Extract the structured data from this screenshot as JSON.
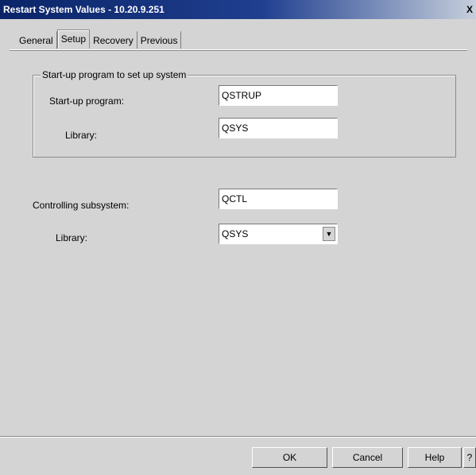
{
  "window": {
    "title": "Restart System Values - 10.20.9.251",
    "close": "X"
  },
  "tabs": [
    {
      "label": "General"
    },
    {
      "label": "Setup"
    },
    {
      "label": "Recovery"
    },
    {
      "label": "Previous"
    }
  ],
  "startup_group": {
    "legend": "Start-up program to set up system",
    "program_label": "Start-up program:",
    "program_value": "QSTRUP",
    "library_label": "Library:",
    "library_value": "QSYS"
  },
  "controlling": {
    "label": "Controlling subsystem:",
    "value": "QCTL",
    "library_label": "Library:",
    "library_value": "QSYS"
  },
  "buttons": {
    "ok": "OK",
    "cancel": "Cancel",
    "help": "Help",
    "whats_this": "?"
  }
}
